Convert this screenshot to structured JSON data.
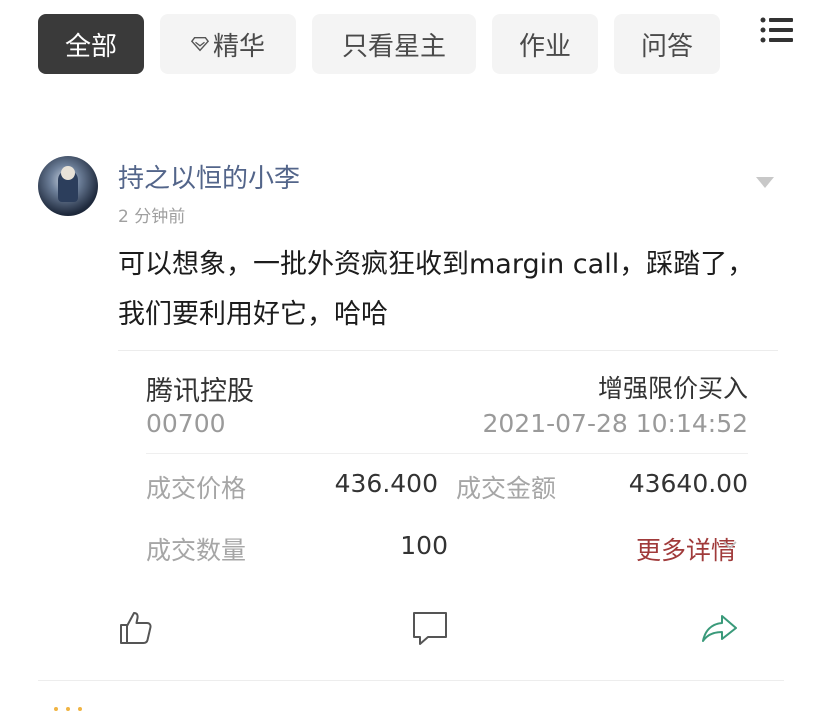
{
  "tabs": [
    {
      "label": "全部",
      "active": true
    },
    {
      "label": "精华",
      "icon": "diamond-icon"
    },
    {
      "label": "只看星主"
    },
    {
      "label": "作业"
    },
    {
      "label": "问答"
    }
  ],
  "menu_icon": "list-menu-icon",
  "post": {
    "author": "持之以恒的小李",
    "time_ago": "2 分钟前",
    "text": "可以想象，一批外资疯狂收到margin call，踩踏了，我们要利用好它，哈哈"
  },
  "trade_card": {
    "stock_name": "腾讯控股",
    "stock_code": "00700",
    "order_type": "增强限价买入",
    "order_time": "2021-07-28 10:14:52",
    "price_label": "成交价格",
    "price_value": "436.400",
    "amount_label": "成交金额",
    "amount_value": "43640.00",
    "qty_label": "成交数量",
    "qty_value": "100",
    "more_label": "更多详情"
  },
  "actions": [
    "like-icon",
    "comment-icon",
    "share-icon"
  ],
  "colors": {
    "active_tab_bg": "#3a3a3a",
    "tab_bg": "#f4f4f4",
    "username": "#53658a",
    "more_link": "#a03a3a",
    "share_icon": "#3a9a7a"
  }
}
